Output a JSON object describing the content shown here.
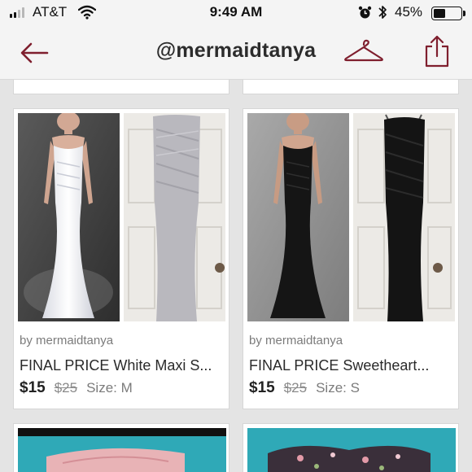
{
  "status_bar": {
    "carrier": "AT&T",
    "time": "9:49 AM",
    "battery_percent": "45%",
    "battery_level": 0.45
  },
  "nav": {
    "title": "@mermaidtanya"
  },
  "listings": [
    {
      "by": "by mermaidtanya",
      "title": "FINAL PRICE White Maxi S...",
      "price": "$15",
      "original_price": "$25",
      "size": "Size: M"
    },
    {
      "by": "by mermaidtanya",
      "title": "FINAL PRICE Sweetheart...",
      "price": "$15",
      "original_price": "$25",
      "size": "Size: S"
    }
  ],
  "colors": {
    "brand": "#7f1f2e",
    "status_dark": "#111111",
    "text_primary": "#2a2a2a",
    "text_muted": "#7b7b7b"
  }
}
